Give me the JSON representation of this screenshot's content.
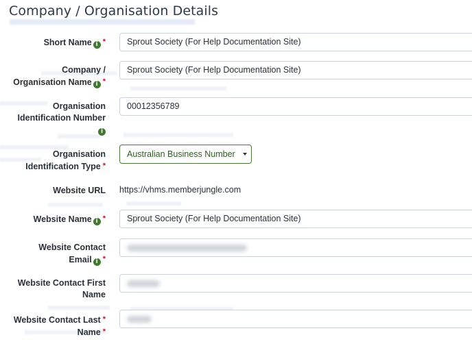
{
  "section": {
    "title": "Company / Organisation Details"
  },
  "fields": {
    "short_name": {
      "label": "Short Name",
      "value": "Sprout Society (For Help Documentation Site)"
    },
    "company_name": {
      "label_line1": "Company /",
      "label_line2": "Organisation Name",
      "value": "Sprout Society (For Help Documentation Site)"
    },
    "org_id_number": {
      "label_line1": "Organisation",
      "label_line2": "Identification Number",
      "value": "00012356789"
    },
    "org_id_type": {
      "label_line1": "Organisation",
      "label_line2": "Identification Type",
      "value": "Australian Business Number"
    },
    "website_url": {
      "label": "Website URL",
      "value": "https://vhms.memberjungle.com"
    },
    "website_name": {
      "label": "Website Name",
      "value": "Sprout Society (For Help Documentation Site)"
    },
    "website_contact_email": {
      "label_line1": "Website Contact",
      "label_line2": "Email"
    },
    "website_contact_first_name": {
      "label_line1": "Website Contact First",
      "label_line2": "Name"
    },
    "website_contact_last_name": {
      "label_line1": "Website Contact Last",
      "label_line2": "Name"
    }
  },
  "icons": {
    "info": "info-icon",
    "required": "*"
  },
  "colors": {
    "info_green": "#3f7a2e",
    "required_red": "#c8102e",
    "select_border": "#4a7a36"
  }
}
